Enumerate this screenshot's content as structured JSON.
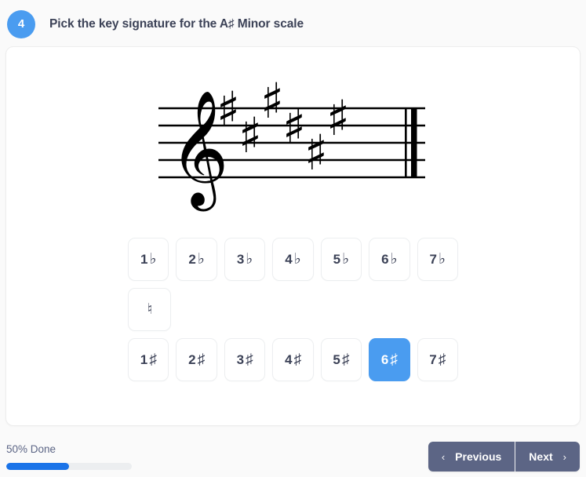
{
  "question": {
    "number": "4",
    "prompt": "Pick the key signature for the A♯ Minor scale"
  },
  "staff": {
    "clef": "treble-clef",
    "accidental_type": "sharp",
    "accidental_count": 6,
    "accidental_glyph": "♯",
    "barline": "final-double-barline"
  },
  "answers": {
    "flats_row": [
      {
        "num": "1",
        "acc": "♭",
        "selected": false
      },
      {
        "num": "2",
        "acc": "♭",
        "selected": false
      },
      {
        "num": "3",
        "acc": "♭",
        "selected": false
      },
      {
        "num": "4",
        "acc": "♭",
        "selected": false
      },
      {
        "num": "5",
        "acc": "♭",
        "selected": false
      },
      {
        "num": "6",
        "acc": "♭",
        "selected": false
      },
      {
        "num": "7",
        "acc": "♭",
        "selected": false
      }
    ],
    "natural_row": [
      {
        "num": "",
        "acc": "♮",
        "selected": false
      }
    ],
    "sharps_row": [
      {
        "num": "1",
        "acc": "♯",
        "selected": false
      },
      {
        "num": "2",
        "acc": "♯",
        "selected": false
      },
      {
        "num": "3",
        "acc": "♯",
        "selected": false
      },
      {
        "num": "4",
        "acc": "♯",
        "selected": false
      },
      {
        "num": "5",
        "acc": "♯",
        "selected": false
      },
      {
        "num": "6",
        "acc": "♯",
        "selected": true
      },
      {
        "num": "7",
        "acc": "♯",
        "selected": false
      }
    ]
  },
  "footer": {
    "progress_label": "50% Done",
    "progress_percent": 50,
    "previous_label": "Previous",
    "next_label": "Next",
    "chevron_left": "‹",
    "chevron_right": "›"
  },
  "colors": {
    "accent_blue": "#4a9cf0",
    "progress_blue": "#1a73e8",
    "nav_slate": "#5c6585",
    "text_dark": "#3c4257"
  }
}
